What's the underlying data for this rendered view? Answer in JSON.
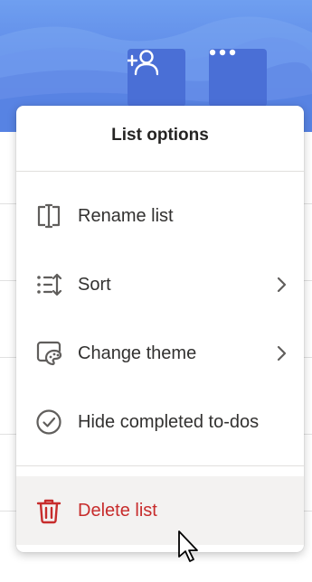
{
  "header": {
    "share_icon": "add-person-icon",
    "more_icon": "more-horizontal-icon"
  },
  "menu": {
    "title": "List options",
    "items": [
      {
        "label": "Rename list",
        "icon": "rename-icon",
        "has_submenu": false
      },
      {
        "label": "Sort",
        "icon": "sort-icon",
        "has_submenu": true
      },
      {
        "label": "Change theme",
        "icon": "theme-icon",
        "has_submenu": true
      },
      {
        "label": "Hide completed to-dos",
        "icon": "checkmark-circle-icon",
        "has_submenu": false
      },
      {
        "label": "Delete list",
        "icon": "trash-icon",
        "has_submenu": false
      }
    ]
  },
  "colors": {
    "accent": "#4f78de",
    "danger": "#c72c2c",
    "hover_bg": "#f3f2f1"
  }
}
